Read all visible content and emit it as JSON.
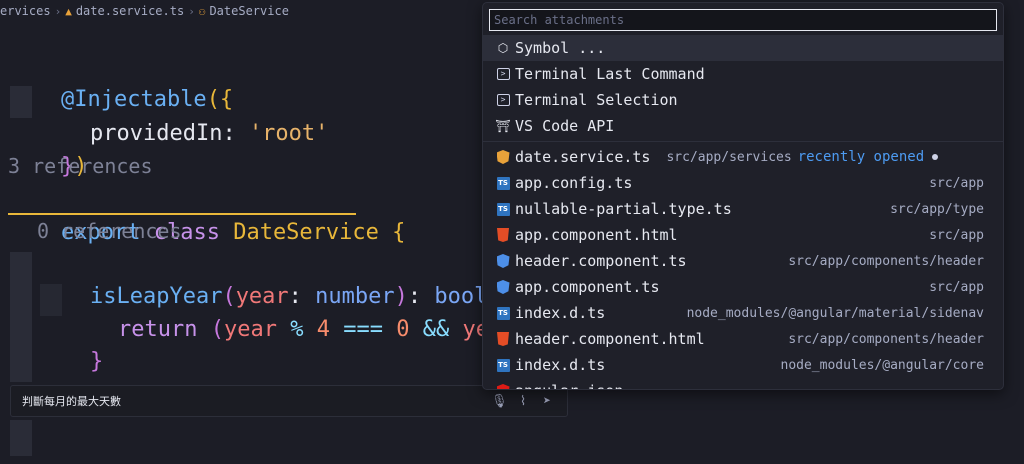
{
  "breadcrumb": {
    "items": [
      "ervices",
      "date.service.ts",
      "DateService"
    ]
  },
  "editor": {
    "lines": {
      "l1": {
        "decorator": "@Injectable",
        "open": "({"
      },
      "l2": {
        "prop": "providedIn",
        "colon": ": ",
        "value": "'root'"
      },
      "l3": {
        "close_brace": "}",
        "close_paren": ")"
      },
      "l4": {
        "references": "3 references"
      },
      "l5": {
        "kw1": "export",
        "kw2": "class",
        "name": "DateService",
        "brace": "{"
      },
      "l6": {
        "references": "0 references"
      },
      "l7": {
        "fn": "isLeapYear",
        "paren_open": "(",
        "param": "year",
        "colon": ": ",
        "type": "number",
        "paren_close": ")",
        "colon2": ": ",
        "ret": "boolea"
      },
      "l8": {
        "kw": "return",
        "paren": "(",
        "param": "year",
        "op1": "%",
        "num1": "4",
        "op2": "===",
        "num2": "0",
        "op3": "&&",
        "param2": "year"
      },
      "l9": {
        "brace": "}"
      }
    }
  },
  "chat": {
    "text": "判斷每月的最大天數",
    "icons": [
      "microphone-icon",
      "paperclip-icon",
      "send-icon"
    ]
  },
  "attachments": {
    "search_placeholder": "Search attachments",
    "commands": [
      {
        "label": "Symbol ...",
        "icon": "cube-icon"
      },
      {
        "label": "Terminal Last Command",
        "icon": "terminal-icon"
      },
      {
        "label": "Terminal Selection",
        "icon": "terminal-icon"
      },
      {
        "label": "VS Code API",
        "icon": "library-icon"
      }
    ],
    "files": [
      {
        "name": "date.service.ts",
        "path": "src/app/services",
        "status": "recently opened",
        "icon": "angular-service-icon"
      },
      {
        "name": "app.config.ts",
        "path": "src/app",
        "icon": "typescript-icon"
      },
      {
        "name": "nullable-partial.type.ts",
        "path": "src/app/type",
        "icon": "typescript-icon"
      },
      {
        "name": "app.component.html",
        "path": "src/app",
        "icon": "html-icon"
      },
      {
        "name": "header.component.ts",
        "path": "src/app/components/header",
        "icon": "angular-component-icon"
      },
      {
        "name": "app.component.ts",
        "path": "src/app",
        "icon": "angular-component-icon"
      },
      {
        "name": "index.d.ts",
        "path": "node_modules/@angular/material/sidenav",
        "icon": "typescript-icon"
      },
      {
        "name": "header.component.html",
        "path": "src/app/components/header",
        "icon": "html-icon"
      },
      {
        "name": "index.d.ts",
        "path": "node_modules/@angular/core",
        "icon": "typescript-icon"
      },
      {
        "name": "angular.json",
        "path": "",
        "icon": "angular-icon"
      }
    ]
  }
}
